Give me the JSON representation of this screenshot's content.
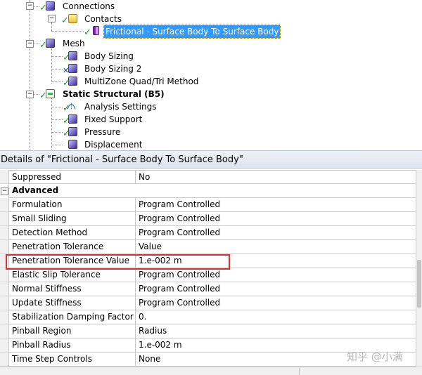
{
  "tree": {
    "connections": "Connections",
    "contacts": "Contacts",
    "frictional": "Frictional - Surface Body To Surface Body",
    "mesh": "Mesh",
    "body_sizing": "Body Sizing",
    "body_sizing_2": "Body Sizing 2",
    "multizone": "MultiZone Quad/Tri Method",
    "static_structural": "Static Structural (B5)",
    "analysis_settings": "Analysis Settings",
    "fixed_support": "Fixed Support",
    "pressure": "Pressure",
    "displacement": "Displacement"
  },
  "details": {
    "title": "Details of \"Frictional - Surface Body To Surface Body\"",
    "rows": [
      {
        "name": "Suppressed",
        "value": "No"
      },
      {
        "group": "Advanced"
      },
      {
        "name": "Formulation",
        "value": "Program Controlled"
      },
      {
        "name": "Small Sliding",
        "value": "Program Controlled"
      },
      {
        "name": "Detection Method",
        "value": "Program Controlled"
      },
      {
        "name": "Penetration Tolerance",
        "value": "Value"
      },
      {
        "name": "Penetration Tolerance Value",
        "value": "1.e-002 m"
      },
      {
        "name": "Elastic Slip Tolerance",
        "value": "Program Controlled"
      },
      {
        "name": "Normal Stiffness",
        "value": "Program Controlled"
      },
      {
        "name": "Update Stiffness",
        "value": "Program Controlled"
      },
      {
        "name": "Stabilization Damping Factor",
        "value": "0."
      },
      {
        "name": "Pinball Region",
        "value": "Radius"
      },
      {
        "name": "Pinball Radius",
        "value": "1.e-002 m"
      },
      {
        "name": "Time Step Controls",
        "value": "None"
      }
    ]
  },
  "watermark": "知乎 @小满",
  "colors": {
    "selection": "#3399ff",
    "check": "#1e9b2a",
    "highlight_box": "#d9302b"
  }
}
